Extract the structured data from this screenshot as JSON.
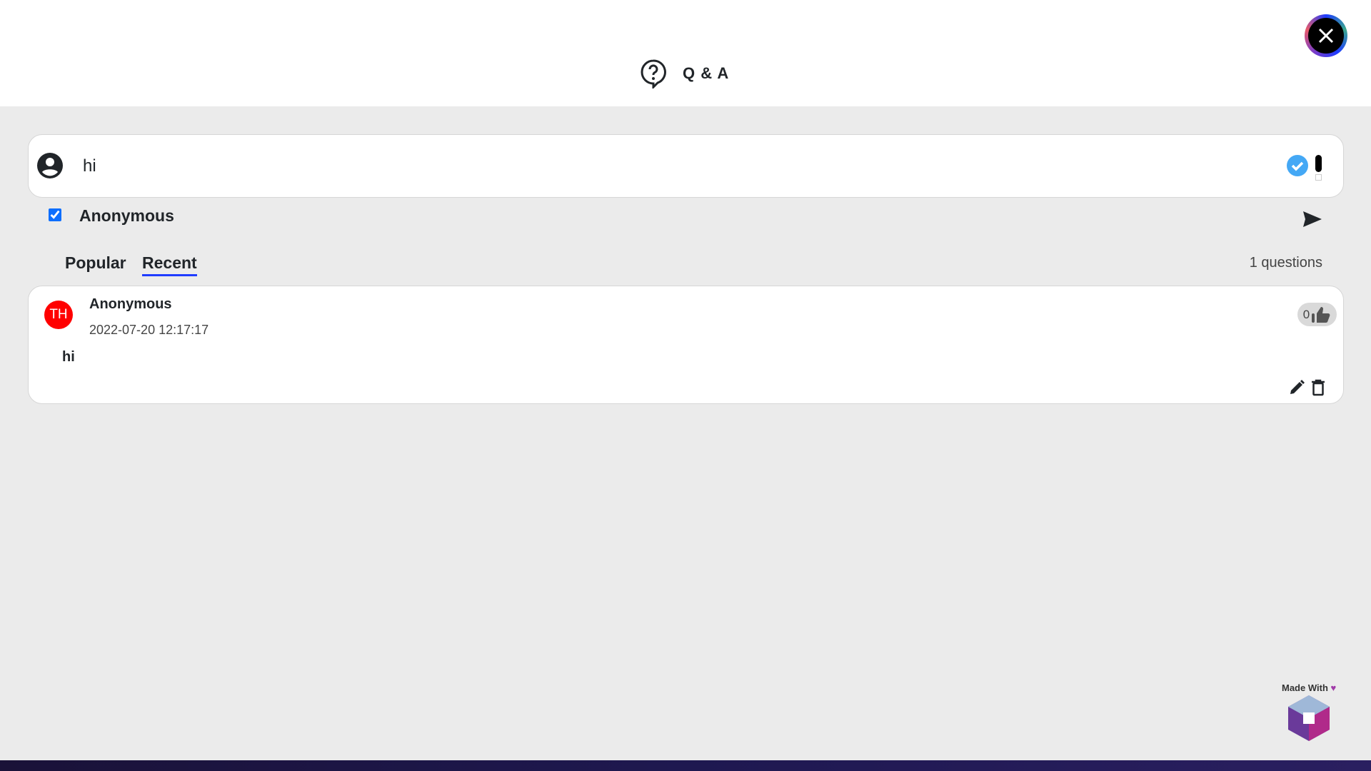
{
  "header": {
    "title": "Q & A",
    "icon": "question-bubble-icon",
    "close_icon": "close-icon"
  },
  "composer": {
    "value": "hi",
    "placeholder": "",
    "anonymous_label": "Anonymous",
    "anonymous_checked": true,
    "icons": [
      "user-circle-icon",
      "check-circle-icon",
      "send-icon"
    ]
  },
  "tabs": [
    {
      "label": "Popular",
      "active": false
    },
    {
      "label": "Recent",
      "active": true
    }
  ],
  "question_count": "1 questions",
  "questions": [
    {
      "avatar_initials": "TH",
      "author": "Anonymous",
      "timestamp": "2022-07-20 12:17:17",
      "text": "hi",
      "likes": "0"
    }
  ],
  "footer": {
    "made_with": "Made With"
  },
  "colors": {
    "accent": "#1f3cff",
    "avatar": "#ff0000",
    "check": "#44a8f5"
  }
}
